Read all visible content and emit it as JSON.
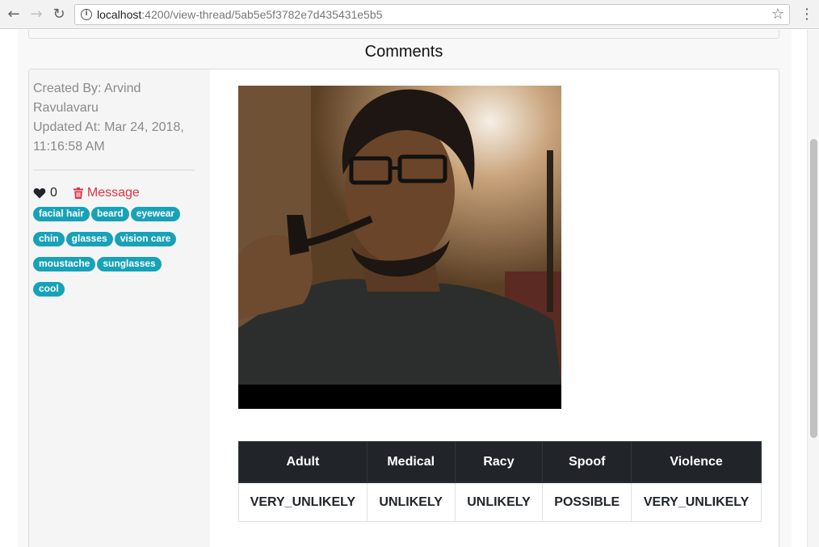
{
  "browser": {
    "url_host": "localhost",
    "url_path": ":4200/view-thread/5ab5e5f3782e7d435431e5b5"
  },
  "page": {
    "comments_heading": "Comments"
  },
  "comment": {
    "created_by_line1": "Created By: Arvind",
    "created_by_line2": "Ravulavaru",
    "updated_at_line1": "Updated At: Mar 24, 2018,",
    "updated_at_line2": "11:16:58 AM",
    "like_count": "0",
    "delete_label": "Message",
    "tag_rows": [
      [
        "facial hair",
        "beard",
        "eyewear"
      ],
      [
        "chin",
        "glasses",
        "vision care"
      ],
      [
        "moustache",
        "sunglasses"
      ],
      [
        "cool"
      ]
    ],
    "safe_search": {
      "headers": [
        "Adult",
        "Medical",
        "Racy",
        "Spoof",
        "Violence"
      ],
      "values": [
        "VERY_UNLIKELY",
        "UNLIKELY",
        "UNLIKELY",
        "POSSIBLE",
        "VERY_UNLIKELY"
      ]
    }
  },
  "colors": {
    "tag": "#17a2b8",
    "delete": "#dc3545",
    "table_header": "#212529"
  }
}
